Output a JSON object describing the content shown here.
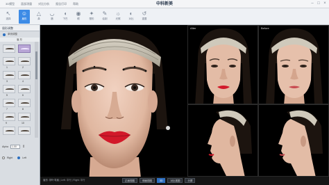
{
  "window": {
    "title": "中科新美",
    "controls": [
      "–",
      "□",
      "×"
    ]
  },
  "tabs": [
    {
      "label": "3D模型"
    },
    {
      "label": "面部测量"
    },
    {
      "label": "对比分析"
    },
    {
      "label": "报告打印"
    },
    {
      "label": "帮助"
    }
  ],
  "toolbar": [
    {
      "icon": "cursor-icon",
      "glyph": "↖",
      "label": "选择"
    },
    {
      "icon": "face-icon",
      "glyph": "☺",
      "label": "眉形"
    },
    {
      "icon": "nose-icon",
      "glyph": "△",
      "label": "鼻"
    },
    {
      "icon": "lips-icon",
      "glyph": "◡",
      "label": "唇"
    },
    {
      "icon": "chin-icon",
      "glyph": "◖",
      "label": "下巴"
    },
    {
      "icon": "eye-icon",
      "glyph": "◉",
      "label": "眼"
    },
    {
      "icon": "sculpt-icon",
      "glyph": "✦",
      "label": "塑形"
    },
    {
      "icon": "brush-icon",
      "glyph": "✎",
      "label": "绘制"
    },
    {
      "icon": "light-icon",
      "glyph": "☼",
      "label": "光照"
    },
    {
      "icon": "contrast-icon",
      "glyph": "◐",
      "label": "对比"
    },
    {
      "icon": "reset-icon",
      "glyph": "↺",
      "label": "重置"
    }
  ],
  "left_panel": {
    "header": "眉形调整",
    "mode_option": "单侧调整",
    "section_label": "眉 形",
    "row_numbers": [
      "1",
      "2",
      "3",
      "4",
      "5",
      "6",
      "7",
      "8",
      "9",
      "10"
    ],
    "alpha_label": "Alpha",
    "alpha_value": "1.00",
    "right_label": "Right",
    "left_label": "Left"
  },
  "viewport": {
    "after_label": "After",
    "before_label": "Before"
  },
  "status": {
    "text": "眉形: 柳叶弯眉 | Left: 平行 | Right: 平行",
    "buttons": [
      "正面视图",
      "侧面视图",
      "3D",
      "对比视图",
      "分屏"
    ]
  },
  "colors": {
    "accent": "#3d8be6",
    "selected_brow": "#b9a6d6"
  }
}
